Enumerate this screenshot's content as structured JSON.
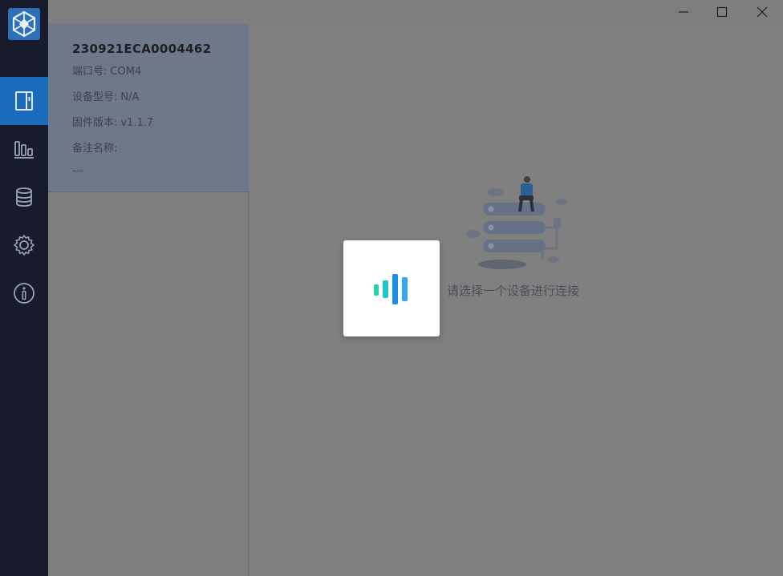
{
  "window": {
    "controls": {
      "minimize_icon": "minimize-icon",
      "maximize_icon": "maximize-icon",
      "close_icon": "close-icon"
    }
  },
  "sidebar": {
    "logo_icon": "app-logo-icon",
    "items": [
      {
        "id": "devices",
        "icon": "device-icon",
        "active": true
      },
      {
        "id": "statistics",
        "icon": "bar-chart-icon",
        "active": false
      },
      {
        "id": "database",
        "icon": "database-icon",
        "active": false
      },
      {
        "id": "settings",
        "icon": "gear-icon",
        "active": false
      },
      {
        "id": "about",
        "icon": "info-icon",
        "active": false
      }
    ],
    "colors": {
      "background": "#171b2c",
      "active": "#1a6bbd"
    }
  },
  "device": {
    "serial": "230921ECA0004462",
    "port_label": "端口号:",
    "port_value": "COM4",
    "model_label": "设备型号:",
    "model_value": "N/A",
    "firmware_label": "固件版本:",
    "firmware_value": "v1.1.7",
    "note_label": "备注名称:",
    "note_value": "---"
  },
  "main": {
    "empty_message": "请选择一个设备进行连接",
    "illustration": "server-with-person-illustration"
  },
  "loading": {
    "icon": "loading-bars-icon",
    "colors": [
      "#22d3a5",
      "#1fc6c7",
      "#1a8ee8",
      "#3aa5f2"
    ]
  }
}
